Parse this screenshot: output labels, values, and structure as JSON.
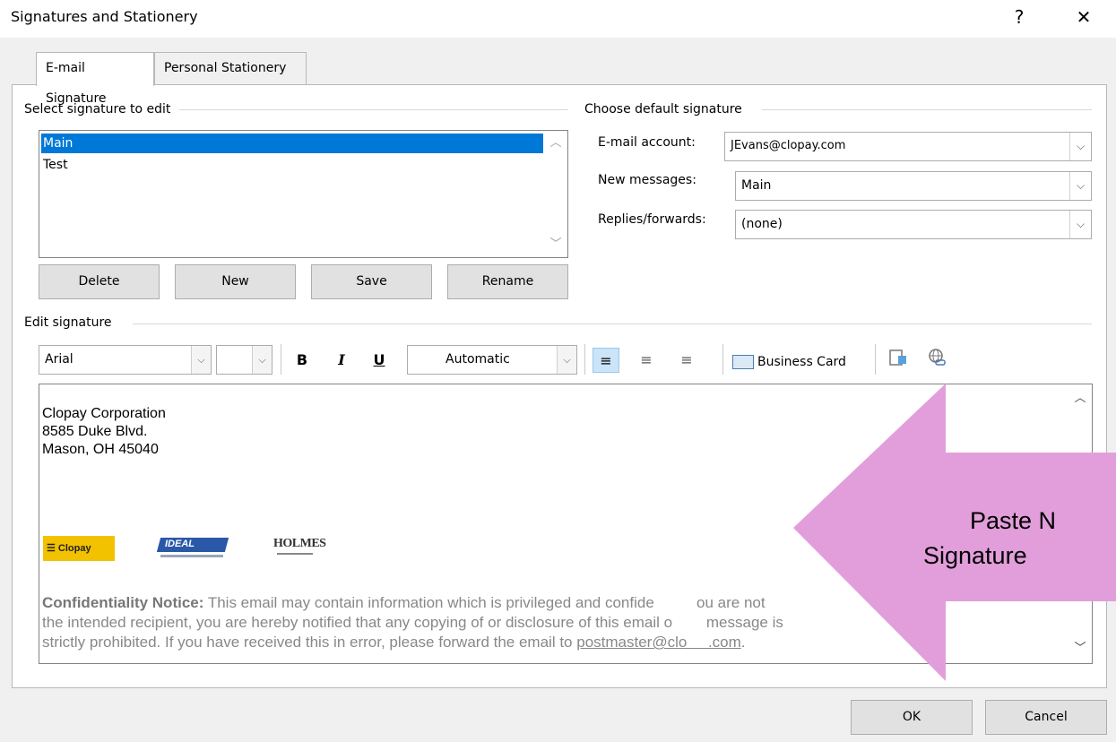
{
  "window": {
    "title": "Signatures and Stationery",
    "help_glyph": "?",
    "close_glyph": "✕"
  },
  "tabs": [
    {
      "label": "E-mail Signature",
      "underline": "E"
    },
    {
      "label": "Personal Stationery",
      "underline": "P"
    }
  ],
  "select_section": {
    "label": "Select signature to edit"
  },
  "signatures": [
    {
      "name": "Main",
      "selected": true
    },
    {
      "name": "Test",
      "selected": false
    }
  ],
  "buttons": {
    "delete": "Delete",
    "new": "New",
    "save": "Save",
    "rename": "Rename",
    "ok": "OK",
    "cancel": "Cancel"
  },
  "default_section": {
    "label": "Choose default signature",
    "email_account_label": "E-mail account:",
    "email_account_value": "JEvans@clopay.com",
    "new_messages_label": "New messages:",
    "new_messages_value": "Main",
    "replies_label": "Replies/forwards:",
    "replies_value": "(none)"
  },
  "edit_section": {
    "label": "Edit signature"
  },
  "toolbar": {
    "font": "Arial",
    "size": "",
    "bold": "B",
    "italic": "I",
    "underline": "U",
    "color": "Automatic",
    "business_card": "Business Card"
  },
  "signature_body": {
    "lines": [
      "Clopay Corporation",
      "8585 Duke Blvd.",
      "Mason, OH 45040"
    ],
    "logos": [
      "Clopay",
      "IDEAL",
      "HOLMES"
    ],
    "confidentiality_heading": "Confidentiality Notice:",
    "confidentiality_text_1": " This email may contain information which is privileged and confide",
    "confidentiality_text_1b": "ou are not",
    "confidentiality_text_2": "the intended recipient, you are hereby notified that any copying of or disclosure of this email o",
    "confidentiality_text_2b": "message is",
    "confidentiality_text_3": "strictly prohibited. If you have received this in error, please forward the email to ",
    "confidentiality_link": "postmaster@clo",
    "confidentiality_link_b": ".com",
    "confidentiality_end": "."
  },
  "callout": {
    "line1": "Paste N",
    "line2": "Signature",
    "color": "#e29edb"
  }
}
